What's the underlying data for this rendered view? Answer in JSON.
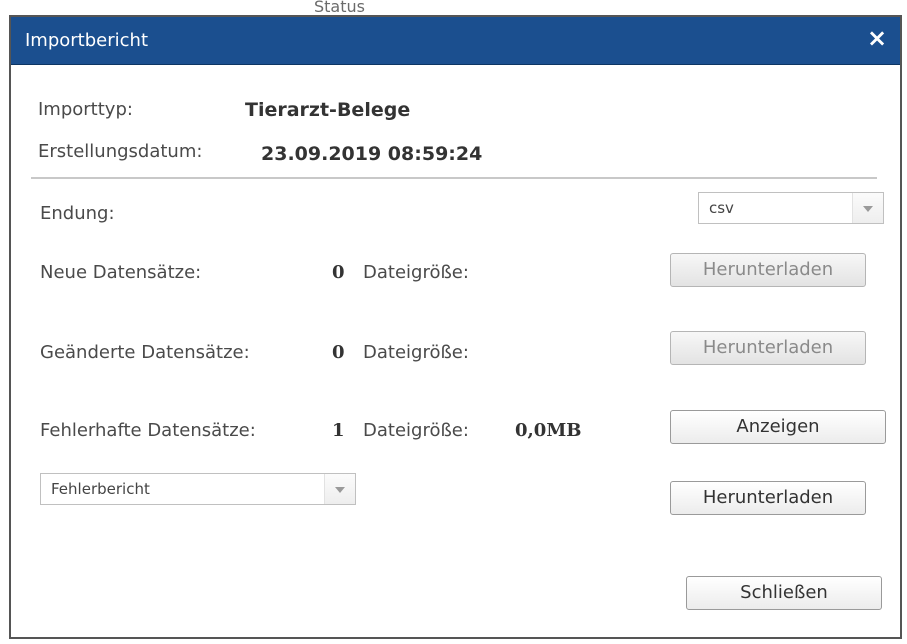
{
  "background": {
    "snippet": "Status"
  },
  "dialog": {
    "title": "Importbericht",
    "close_label": "×",
    "import_type_label": "Importtyp:",
    "import_type_value": "Tierarzt-Belege",
    "created_label": "Erstellungsdatum:",
    "created_value": "23.09.2019 08:59:24",
    "extension_label": "Endung:",
    "extension_value": "csv",
    "rows": [
      {
        "label": "Neue Datensätze:",
        "count": "0",
        "size_label": "Dateigröße:",
        "size_value": "",
        "button": "Herunterladen"
      },
      {
        "label": "Geänderte Datensätze:",
        "count": "0",
        "size_label": "Dateigröße:",
        "size_value": "",
        "button": "Herunterladen"
      },
      {
        "label": "Fehlerhafte Datensätze:",
        "count": "1",
        "size_label": "Dateigröße:",
        "size_value": "0,0MB",
        "button": "Anzeigen"
      }
    ],
    "report_select_value": "Fehlerbericht",
    "report_download_label": "Herunterladen",
    "close_button_label": "Schließen"
  },
  "colors": {
    "titlebar": "#1b4f8f",
    "title_text": "#ffffff"
  }
}
